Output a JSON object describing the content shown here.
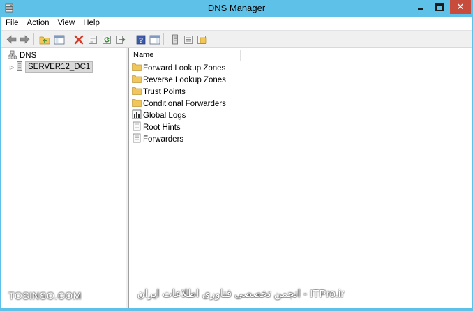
{
  "window": {
    "title": "DNS Manager",
    "accent_color": "#5ec1e8",
    "close_color": "#c74c3c"
  },
  "menu": {
    "items": [
      "File",
      "Action",
      "View",
      "Help"
    ]
  },
  "toolbar": {
    "icons": [
      "back-arrow-icon",
      "forward-arrow-icon",
      "up-folder-icon",
      "show-hide-console-tree-icon",
      "delete-icon",
      "properties-icon",
      "refresh-icon",
      "export-list-icon",
      "help-icon",
      "show-action-pane-icon",
      "server-icon",
      "list-view-icon",
      "new-zone-icon"
    ]
  },
  "tree": {
    "root_label": "DNS",
    "server_label": "SERVER12_DC1"
  },
  "list": {
    "column_header": "Name",
    "items": [
      {
        "label": "Forward Lookup Zones",
        "icon": "folder-icon"
      },
      {
        "label": "Reverse Lookup Zones",
        "icon": "folder-icon"
      },
      {
        "label": "Trust Points",
        "icon": "folder-icon"
      },
      {
        "label": "Conditional Forwarders",
        "icon": "folder-icon"
      },
      {
        "label": "Global Logs",
        "icon": "log-icon"
      },
      {
        "label": "Root Hints",
        "icon": "document-icon"
      },
      {
        "label": "Forwarders",
        "icon": "document-icon"
      }
    ]
  },
  "watermark": {
    "left": "TOSINSO.COM",
    "right": "ITPro.ir - انجمن تخصصی فناوری اطلاعات ایران"
  }
}
